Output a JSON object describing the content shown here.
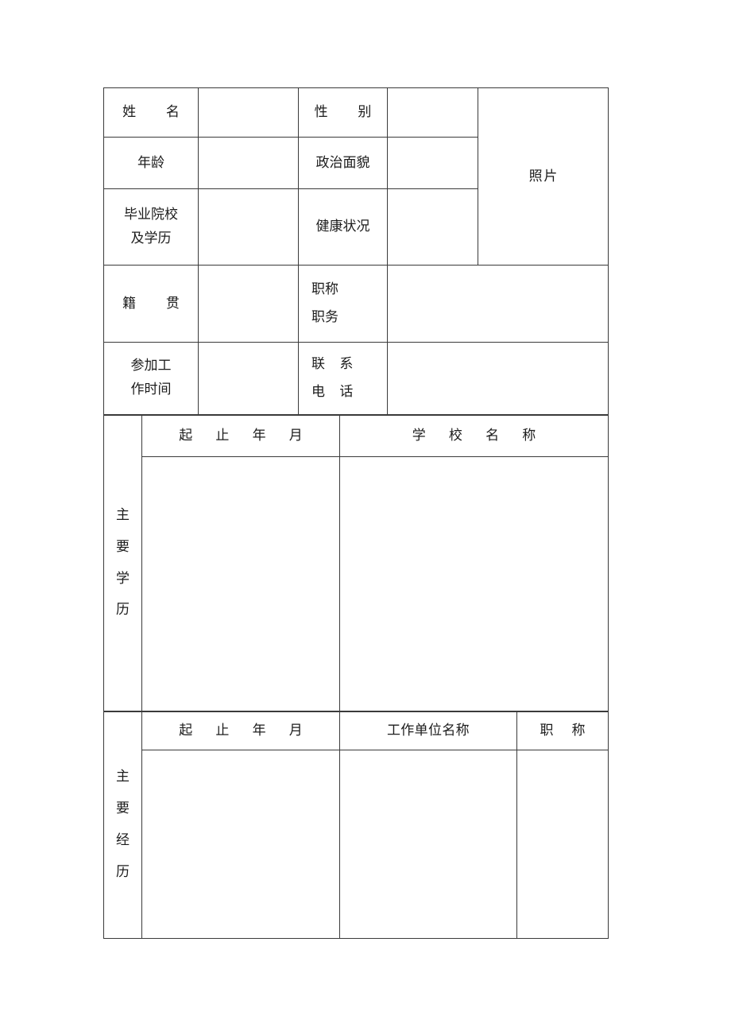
{
  "document": {
    "kind": "personal-resume-form",
    "language": "zh-CN"
  },
  "personal_info": {
    "rows": [
      {
        "label_left": "姓    名",
        "value_left": "",
        "label_right": "性    别",
        "value_right": ""
      },
      {
        "label_left": "年龄",
        "value_left": "",
        "label_right": "政治面貌",
        "value_right": ""
      },
      {
        "label_left_line1": "毕业院校",
        "label_left_line2": "及学历",
        "value_left": "",
        "label_right": "健康状况",
        "value_right": ""
      }
    ],
    "photo_label": "照片",
    "photo_value": "",
    "row_origin": {
      "label_left": "籍    贯",
      "value_left": "",
      "label_right_line1": "职称",
      "label_right_line2": "职务",
      "value_right": ""
    },
    "row_worktime": {
      "label_left_line1": "参加工",
      "label_left_line2": "作时间",
      "value_left": "",
      "label_right_line1": "联  系",
      "label_right_line2": "电  话",
      "value_right": ""
    }
  },
  "education_section": {
    "side_label": "主要学历",
    "side_label_chars": [
      "主",
      "要",
      "学",
      "历"
    ],
    "headers": [
      "起  止  年  月",
      "学  校  名  称"
    ],
    "rows": [
      {
        "period": "",
        "school": ""
      }
    ]
  },
  "experience_section": {
    "side_label": "主要经历",
    "side_label_chars": [
      "主",
      "要",
      "经",
      "历"
    ],
    "headers": [
      "起  止  年  月",
      "工作单位名称",
      "职  称"
    ],
    "rows": [
      {
        "period": "",
        "employer": "",
        "title": ""
      }
    ]
  }
}
